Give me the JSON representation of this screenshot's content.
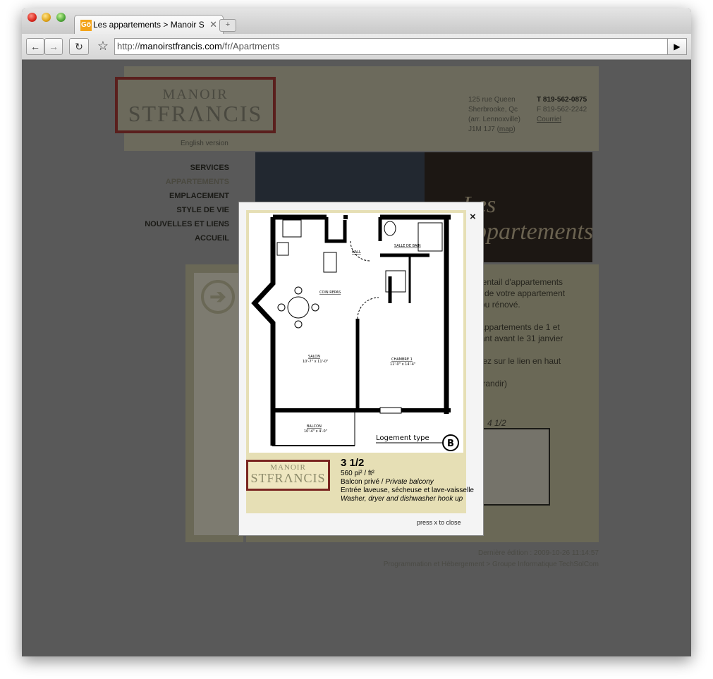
{
  "browser": {
    "tab_favicon": "Gö",
    "tab_title": "Les appartements > Manoir S",
    "tab_close": "✕",
    "newtab": "+",
    "back_icon": "←",
    "forward_icon": "→",
    "reload_icon": "↻",
    "bookmark_icon": "☆",
    "url_scheme": "http://",
    "url_domain": "manoirstfrancis.com",
    "url_path": "/fr/Apartments",
    "go_icon": "▶"
  },
  "site": {
    "logo_line1": "MANOIR",
    "logo_line2": "STFRΛNCIS",
    "english_link": "English version",
    "address": [
      "125 rue Queen",
      "Sherbrooke, Qc",
      "(arr. Lennoxville)",
      "J1M 1J7 ("
    ],
    "map_link": "map",
    "address_close": ")",
    "phone": "T 819-562-0875",
    "fax": "F 819-562-2242",
    "email_link": "Courriel",
    "nav": [
      "SERVICES",
      "APPARTEMENTS",
      "EMPLACEMENT",
      "STYLE DE VIE",
      "NOUVELLES ET LIENS",
      "ACCUEIL"
    ],
    "hero_text": "Les appartements",
    "body_lines": [
      "éventail d'appartements",
      "es de votre appartement",
      "é ou rénové.",
      "s appartements de 1 et",
      "otant avant le 31 janvier",
      "quez sur le lien en haut",
      "agrandir)"
    ],
    "thumb_label": "4 1/2",
    "footer_edit": "Dernière édition : 2009-10-26 11:14:57",
    "footer_credit": "Programmation et Hébergement > Groupe Informatique TechSolCom"
  },
  "modal": {
    "close": "×",
    "plan_labels": {
      "hall": "HALL",
      "bath": "SALLE DE BAIN",
      "dining": "COIN REPAS",
      "living": "SALON",
      "living_dim": "10'-7\" x 11'-0\"",
      "bedroom": "CHAMBRE 1",
      "bedroom_dim": "11'-0\" x 14'-4\"",
      "balcony": "BALCON",
      "balcony_dim": "10'-4\" x 4'-0\"",
      "unit_type": "Logement type",
      "unit_letter": "B"
    },
    "card_logo_line1": "MANOIR",
    "card_logo_line2": "STFRΛNCIS",
    "title": "3 1/2",
    "area": "560 pi² / ft²",
    "balcony_fr": "Balcon privé / ",
    "balcony_en": "Private balcony",
    "hookup_fr": "Entrée laveuse, sécheuse et lave-vaisselle",
    "hookup_en": "Washer, dryer and dishwasher hook up",
    "press_close": "press x to close"
  }
}
